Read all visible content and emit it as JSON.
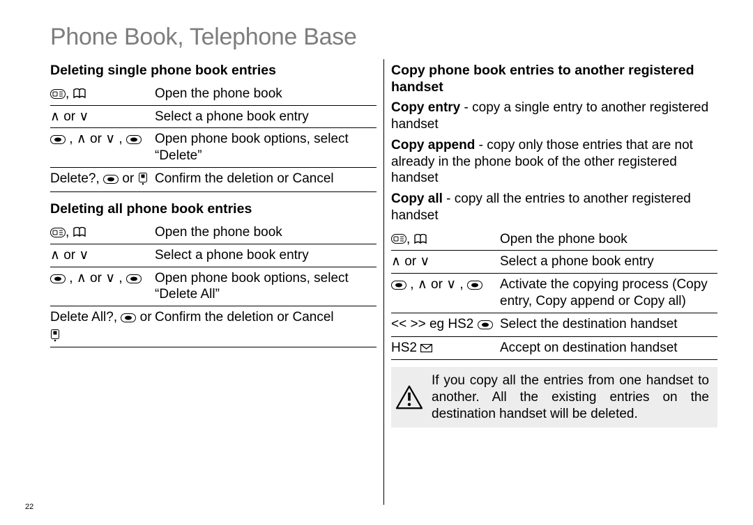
{
  "title": "Phone Book, Telephone Base",
  "pagenum": "22",
  "left": {
    "h1": "Deleting single phone book entries",
    "t1": {
      "r0": {
        "k_sep": ", ",
        "v": "Open the phone book"
      },
      "r1": {
        "k_mid": " or ",
        "v": "Select a phone book entry"
      },
      "r2": {
        "k_sep1": " , ",
        "k_mid": " or ",
        "k_sep2": " , ",
        "v": "Open phone book options, select “Delete”"
      },
      "r3": {
        "k_pre": "Delete?, ",
        "k_mid": " or ",
        "v": "Confirm the deletion or Cancel"
      }
    },
    "h2": "Deleting all phone book entries",
    "t2": {
      "r0": {
        "k_sep": ", ",
        "v": "Open the phone book"
      },
      "r1": {
        "k_mid": " or ",
        "v": "Select a phone book entry"
      },
      "r2": {
        "k_sep1": " , ",
        "k_mid": " or ",
        "k_sep2": " , ",
        "v": "Open phone book options, select “Delete All”"
      },
      "r3": {
        "k_pre": "Delete All?, ",
        "k_mid": " or ",
        "v": "Confirm the deletion or Cancel"
      }
    }
  },
  "right": {
    "h1": "Copy phone book entries to another registered handset",
    "defs": {
      "d0b": "Copy entry",
      "d0": " - copy a single entry to another registered handset",
      "d1b": "Copy append",
      "d1": " - copy only those entries that are not already in the phone book of the other registered handset",
      "d2b": "Copy all",
      "d2": " - copy all the entries to another registered handset"
    },
    "t1": {
      "r0": {
        "k_sep": ", ",
        "v": "Open the phone book"
      },
      "r1": {
        "k_mid": " or ",
        "v": "Select a phone book entry"
      },
      "r2": {
        "k_sep1": " , ",
        "k_mid": " or ",
        "k_sep2": " , ",
        "v": "Activate the copying process (Copy entry, Copy append or Copy all)"
      },
      "r3": {
        "k": "<< >> eg HS2 ",
        "v": "Select the destination handset"
      },
      "r4": {
        "k": "HS2 ",
        "v": "Accept on destination handset"
      }
    },
    "note": "If you copy all the entries from one handset to another. All the existing entries on the destination handset will be deleted."
  }
}
